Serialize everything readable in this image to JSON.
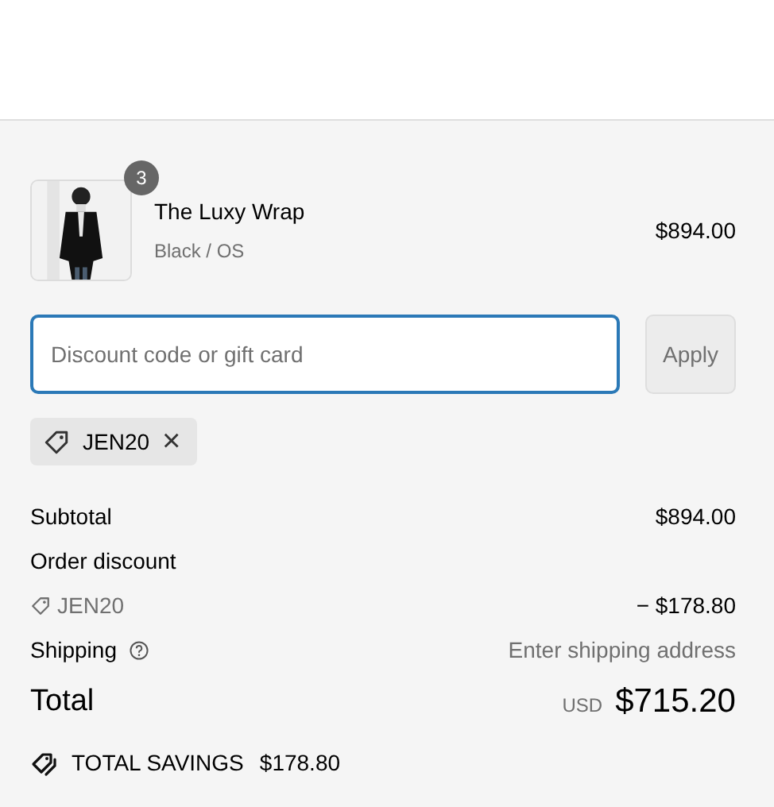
{
  "line_items": [
    {
      "kind": "picture",
      "quantity": "3",
      "name": "The Luxy Wrap",
      "variant": "Black / OS",
      "price": "$894.00"
    }
  ],
  "discount_field": {
    "placeholder": "Discount code or gift card",
    "focused": true
  },
  "apply_button": {
    "label": "Apply",
    "disabled": true
  },
  "applied_codes": [
    {
      "code": "JEN20",
      "remove": "×"
    }
  ],
  "summary": [
    {
      "kind": "plain",
      "label": "Subtotal",
      "value": "$894.00"
    },
    {
      "kind": "heading",
      "label": "Order discount"
    },
    {
      "kind": "code",
      "label": "JEN20",
      "value": "− $178.80"
    },
    {
      "kind": "help",
      "label": "Shipping",
      "value": "Enter shipping address"
    }
  ],
  "total": {
    "label": "Total",
    "currency": "USD",
    "value": "$715.20"
  },
  "savings": {
    "label": "TOTAL SAVINGS",
    "value": "$178.80"
  }
}
